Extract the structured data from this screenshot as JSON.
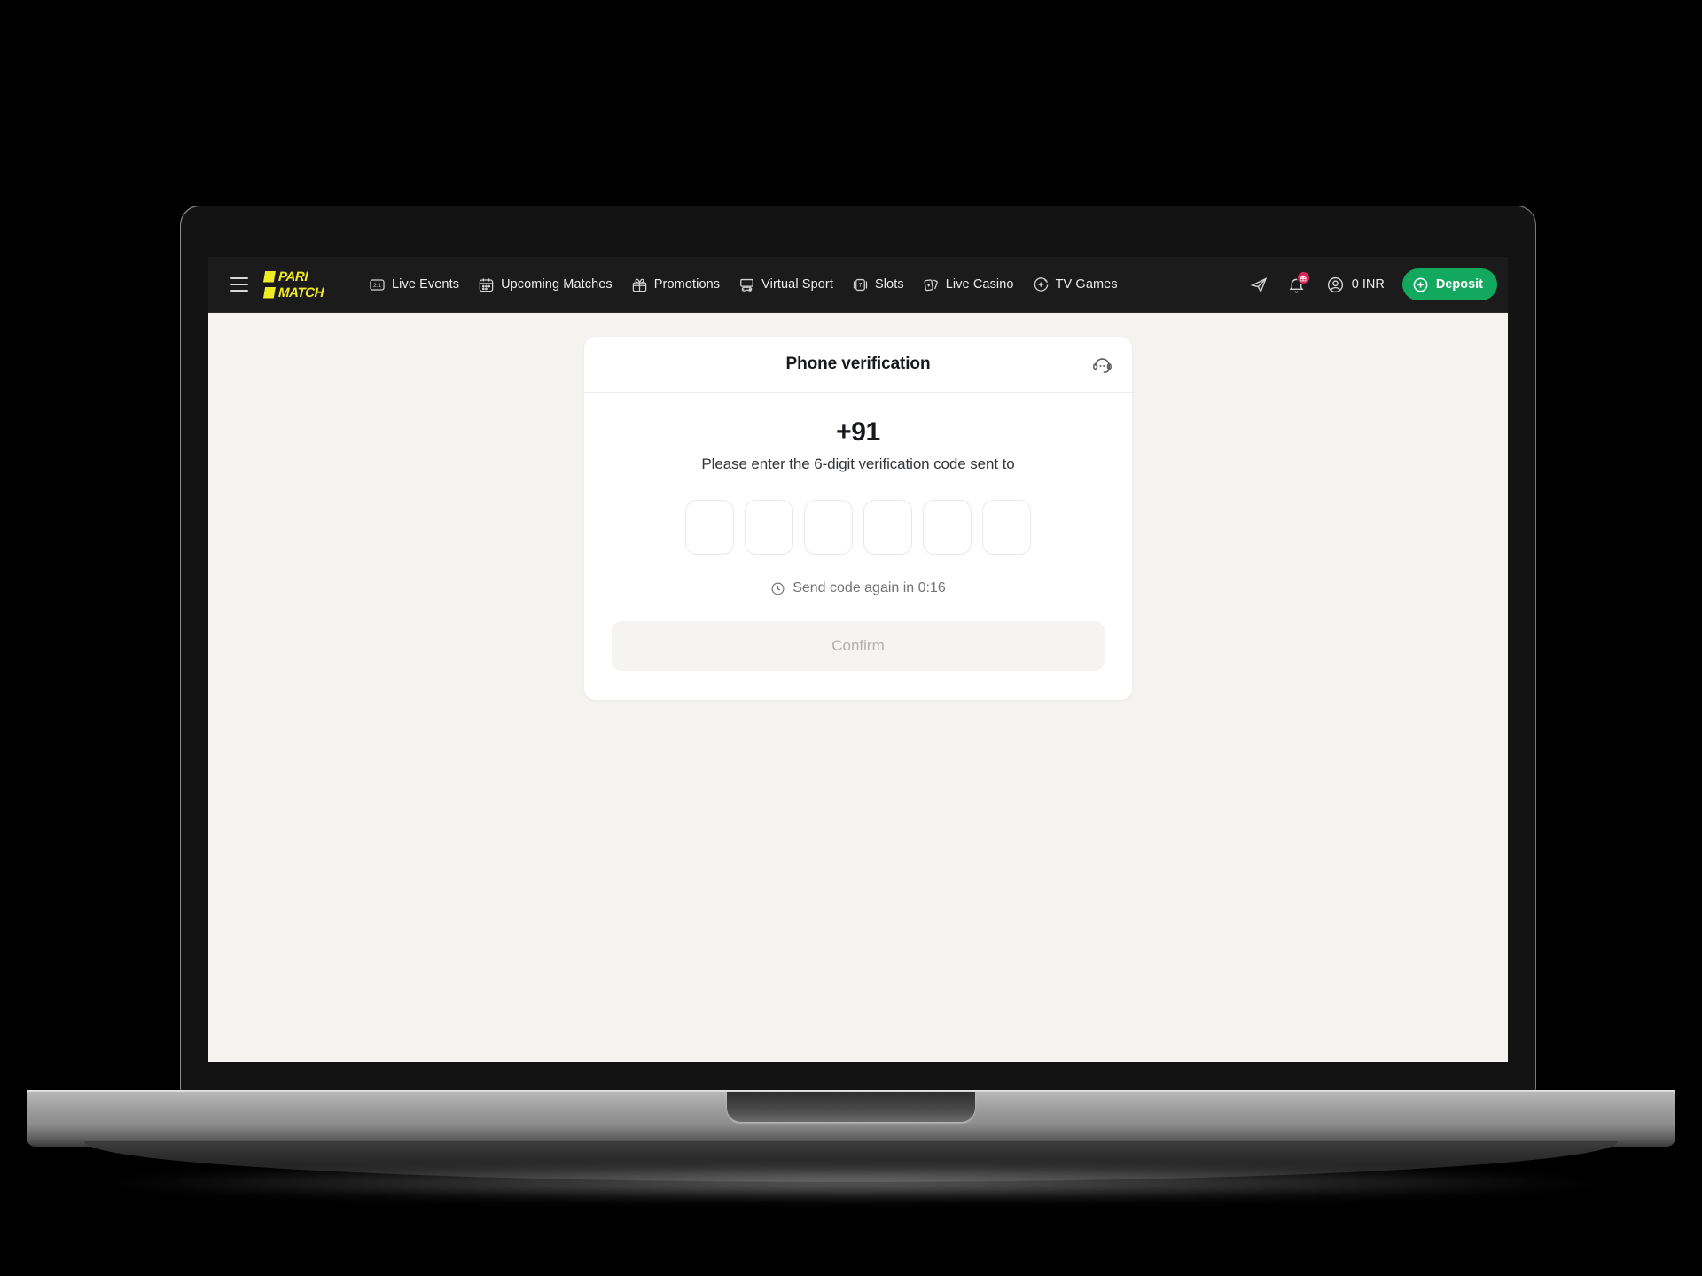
{
  "brand": {
    "logo_line1": "PARI",
    "logo_line2": "MATCH",
    "logo_color": "#f1ea26",
    "accent_green": "#12a85e",
    "badge_color": "#d6285a",
    "navbar_bg": "#1b1b1b",
    "page_bg": "#f4f3f0"
  },
  "navbar": {
    "menu_icon": "hamburger-menu-icon",
    "items": [
      {
        "label": "Live Events",
        "icon": "scoreboard-icon"
      },
      {
        "label": "Upcoming Matches",
        "icon": "calendar-icon"
      },
      {
        "label": "Promotions",
        "icon": "gift-icon"
      },
      {
        "label": "Virtual Sport",
        "icon": "gamepad-icon"
      },
      {
        "label": "Slots",
        "icon": "slot-machine-icon"
      },
      {
        "label": "Live Casino",
        "icon": "playing-cards-icon"
      },
      {
        "label": "TV Games",
        "icon": "sparkle-circle-icon"
      }
    ],
    "telegram_icon": "paper-plane-icon",
    "notifications_icon": "bell-icon",
    "notifications_badge_icon": "gift-icon",
    "account_icon": "user-circle-icon",
    "balance": "0 INR",
    "deposit_label": "Deposit",
    "deposit_icon": "plus-circle-icon"
  },
  "modal": {
    "title": "Phone verification",
    "support_icon": "headset-support-icon",
    "phone_number": "+91",
    "hint": "Please enter the 6-digit verification code sent to",
    "otp": {
      "length": 6,
      "values": [
        "",
        "",
        "",
        "",
        "",
        ""
      ],
      "placeholder": ""
    },
    "resend": {
      "icon": "clock-icon",
      "text": "Send code again in 0:16"
    },
    "confirm_label": "Confirm",
    "confirm_disabled": true
  }
}
